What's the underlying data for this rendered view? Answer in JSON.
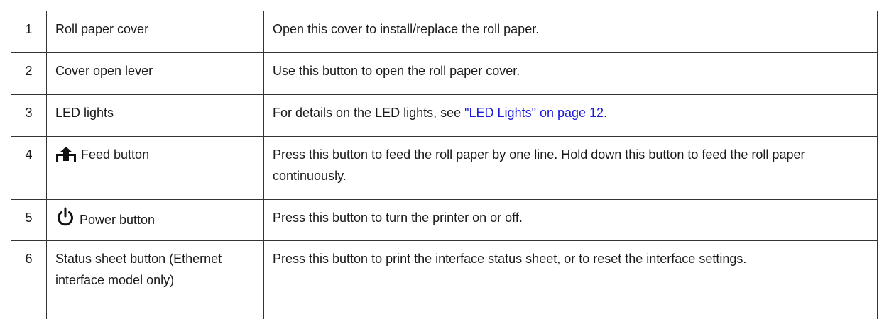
{
  "rows": [
    {
      "num": "1",
      "name": "Roll paper cover",
      "desc": "Open this cover to install/replace the roll paper."
    },
    {
      "num": "2",
      "name": "Cover open lever",
      "desc": "Use this button to open the roll paper cover."
    },
    {
      "num": "3",
      "name": "LED lights",
      "desc_prefix": "For details on the LED lights, see ",
      "desc_link": "\"LED Lights\" on page 12",
      "desc_suffix": "."
    },
    {
      "num": "4",
      "icon": "feed-icon",
      "name": "Feed button",
      "desc": "Press this button to feed the roll paper by one line. Hold down this button to feed the roll paper continuously."
    },
    {
      "num": "5",
      "icon": "power-icon",
      "name": "Power button",
      "desc": "Press this button to turn the printer on or off."
    },
    {
      "num": "6",
      "name": "Status sheet button (Ethernet interface model only)",
      "desc": "Press this button to print the interface status sheet, or to reset the interface settings."
    }
  ],
  "colors": {
    "text": "#1a1a1a",
    "link": "#1a1ad8",
    "border": "#333333"
  }
}
